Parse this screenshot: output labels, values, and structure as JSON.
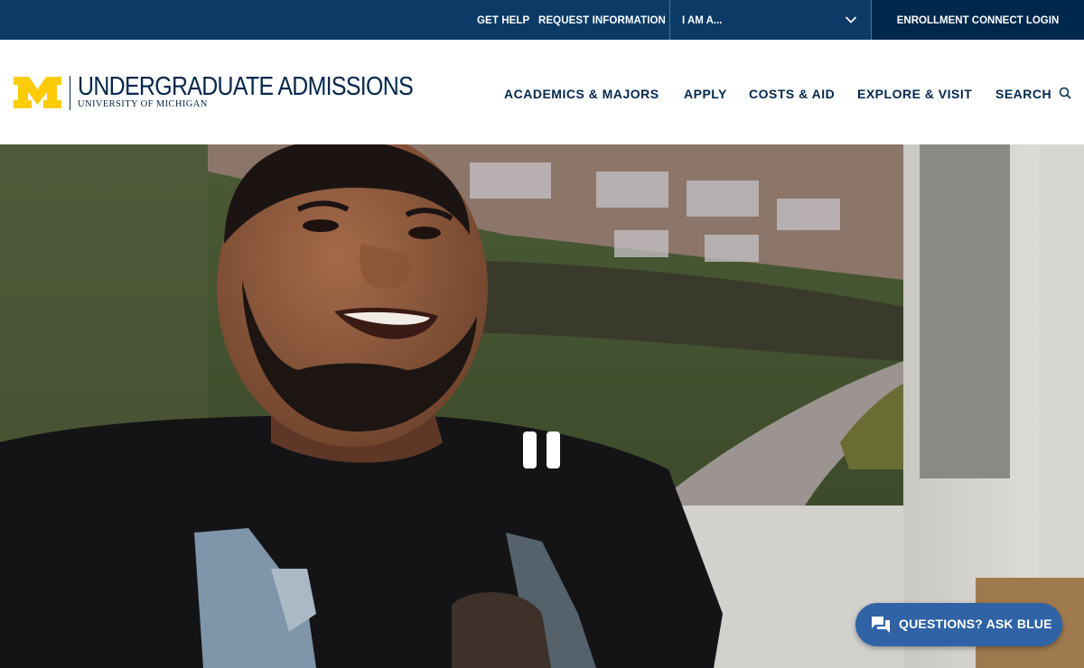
{
  "utility_bar": {
    "get_help": "GET HELP",
    "request_information": "REQUEST INFORMATION",
    "iam_select": {
      "selected": "I AM A...",
      "icon": "chevron-down-icon"
    },
    "enrollment_login": "ENROLLMENT CONNECT LOGIN"
  },
  "header": {
    "logo": {
      "mark": "M",
      "title": "UNDERGRADUATE ADMISSIONS",
      "subtitle": "UNIVERSITY OF MICHIGAN"
    },
    "nav": [
      {
        "label": "ACADEMICS & MAJORS"
      },
      {
        "label": "APPLY"
      },
      {
        "label": "COSTS & AID"
      },
      {
        "label": "EXPLORE & VISIT"
      },
      {
        "label": "SEARCH"
      }
    ],
    "search_icon": "search-icon"
  },
  "hero": {
    "video_state": "playing",
    "pause_icon": "pause-icon",
    "chat_button": {
      "label": "QUESTIONS? ASK BLUE",
      "icon": "chat-icon"
    }
  },
  "colors": {
    "navy": "#00274c",
    "utility_blue": "#0b3a66",
    "maize": "#ffcb05",
    "chat_blue": "#2f63a6"
  }
}
